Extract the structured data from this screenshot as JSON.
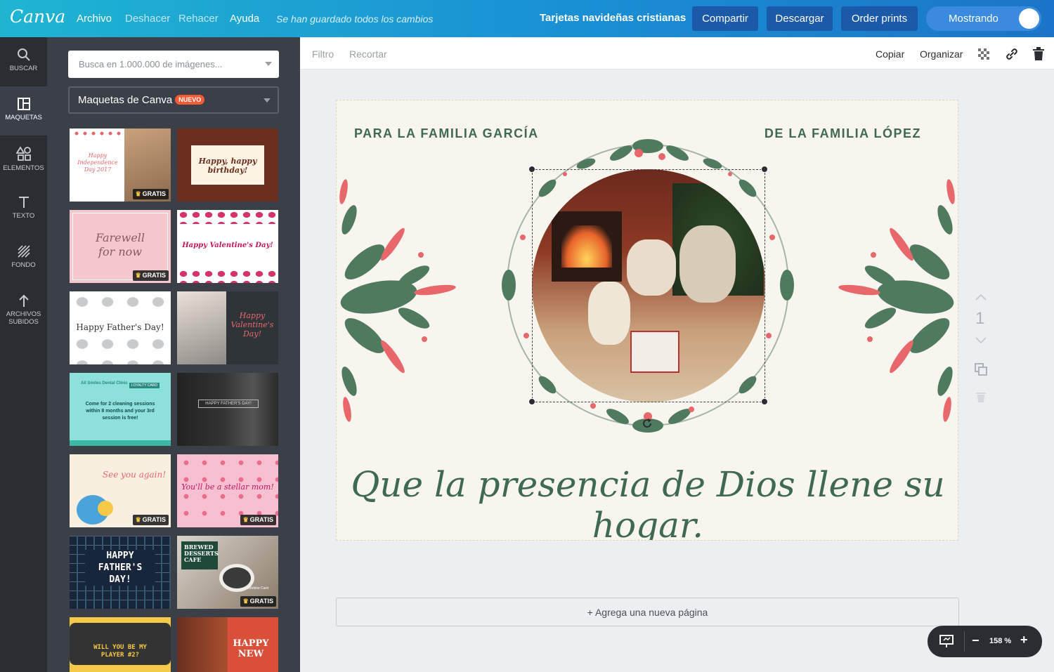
{
  "app": {
    "logo": "Canva"
  },
  "menu": {
    "file": "Archivo",
    "undo": "Deshacer",
    "redo": "Rehacer",
    "help": "Ayuda",
    "save_status": "Se han guardado todos los cambios"
  },
  "header": {
    "doc_title": "Tarjetas navideñas cristianas",
    "share": "Compartir",
    "download": "Descargar",
    "order": "Order prints",
    "showing": "Mostrando"
  },
  "sidebar": {
    "items": [
      {
        "label": "BUSCAR",
        "icon": "search-icon"
      },
      {
        "label": "MAQUETAS",
        "icon": "layout-icon"
      },
      {
        "label": "ELEMENTOS",
        "icon": "shapes-icon"
      },
      {
        "label": "TEXTO",
        "icon": "text-icon"
      },
      {
        "label": "FONDO",
        "icon": "background-icon"
      },
      {
        "label": "ARCHIVOS",
        "label2": "SUBIDOS",
        "icon": "upload-icon"
      }
    ]
  },
  "panel": {
    "search_placeholder": "Busca en 1.000.000 de imágenes...",
    "layouts_label": "Maquetas de Canva",
    "new_badge": "NUEVO",
    "free_badge": "GRATIS",
    "thumbs": [
      {
        "lines": [
          "Happy",
          "Independence",
          "Day 2017"
        ]
      },
      {
        "lines": [
          "Happy, happy",
          "birthday!"
        ]
      },
      {
        "lines": [
          "Farewell",
          "for now"
        ]
      },
      {
        "lines": [
          "Happy Valentine's Day!"
        ]
      },
      {
        "lines": [
          "Happy Father's Day!"
        ]
      },
      {
        "lines": [
          "Happy",
          "Valentine's",
          "Day!"
        ]
      },
      {
        "lines": [
          "Come for 2 cleaning sessions",
          "within 8 months and your 3rd",
          "session is free!"
        ],
        "top": "All Smiles Dental Clinic",
        "tag": "LOYALTY CARD"
      },
      {
        "lines": [
          "HAPPY FATHER'S DAY!"
        ]
      },
      {
        "lines": [
          "See you again!"
        ]
      },
      {
        "lines": [
          "You'll be a stellar mom!"
        ]
      },
      {
        "lines": [
          "HAPPY",
          "FATHER'S",
          "DAY!"
        ]
      },
      {
        "lines": [
          "BREWED",
          "DESSERTS",
          "CAFE"
        ],
        "sub": "Lifetime Card"
      },
      {
        "lines": [
          "WILL YOU BE MY",
          "PLAYER #2?"
        ]
      },
      {
        "lines": [
          "HAPPY",
          "NEW"
        ]
      }
    ]
  },
  "toolbar": {
    "filter": "Filtro",
    "crop": "Recortar",
    "copy": "Copiar",
    "arrange": "Organizar"
  },
  "card": {
    "to": "PARA LA FAMILIA GARCÍA",
    "from": "DE LA FAMILIA LÓPEZ",
    "message": "Que la presencia de Dios llene su hogar."
  },
  "canvas": {
    "add_page": "+ Agrega una nueva página",
    "page_number": "1",
    "zoom": "158 %"
  },
  "colors": {
    "topbar_start": "#1fb5d1",
    "topbar_end": "#1b74c9",
    "card_green": "#3f6a50",
    "card_pink": "#e8676b",
    "card_bg": "#f8f5ee"
  }
}
